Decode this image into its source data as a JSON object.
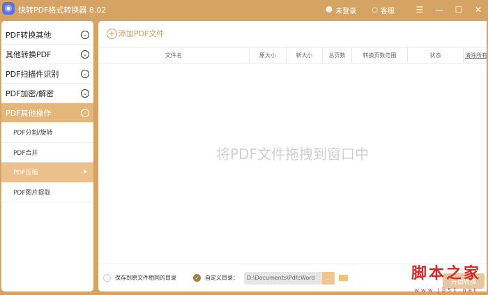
{
  "app": {
    "title": "快转PDF格式转换器 8.02",
    "login": "未登录",
    "service": "客服",
    "menu": "☰",
    "minimize": "—",
    "maximize": "☐",
    "close": "✕"
  },
  "sidebar": {
    "groups": [
      {
        "label": "PDF转换其他"
      },
      {
        "label": "其他转换PDF"
      },
      {
        "label": "PDF扫描件识别"
      },
      {
        "label": "PDF加密/解密"
      },
      {
        "label": "PDF其他操作"
      }
    ],
    "subitems": [
      {
        "label": "PDF分割/旋转"
      },
      {
        "label": "PDF合并"
      },
      {
        "label": "PDF压缩"
      },
      {
        "label": "PDF图片提取"
      }
    ]
  },
  "main": {
    "add_label": "添加PDF文件",
    "columns": [
      "文件名",
      "原大小",
      "新大小",
      "总页数",
      "转换页数范围",
      "状态",
      "清除所有"
    ],
    "drop_hint": "将PDF文件拖拽到窗口中"
  },
  "bottom": {
    "save_same": "保存到原文件相同的目录",
    "custom": "自定义目录：",
    "path": "D:\\Documents\\PdfcWord",
    "browse": "...",
    "start": "开始转换"
  },
  "watermark": {
    "title": "脚本之家",
    "url": "www.jb51.net"
  },
  "colors": {
    "accent": "#d5a464",
    "active": "#e3b67b"
  }
}
